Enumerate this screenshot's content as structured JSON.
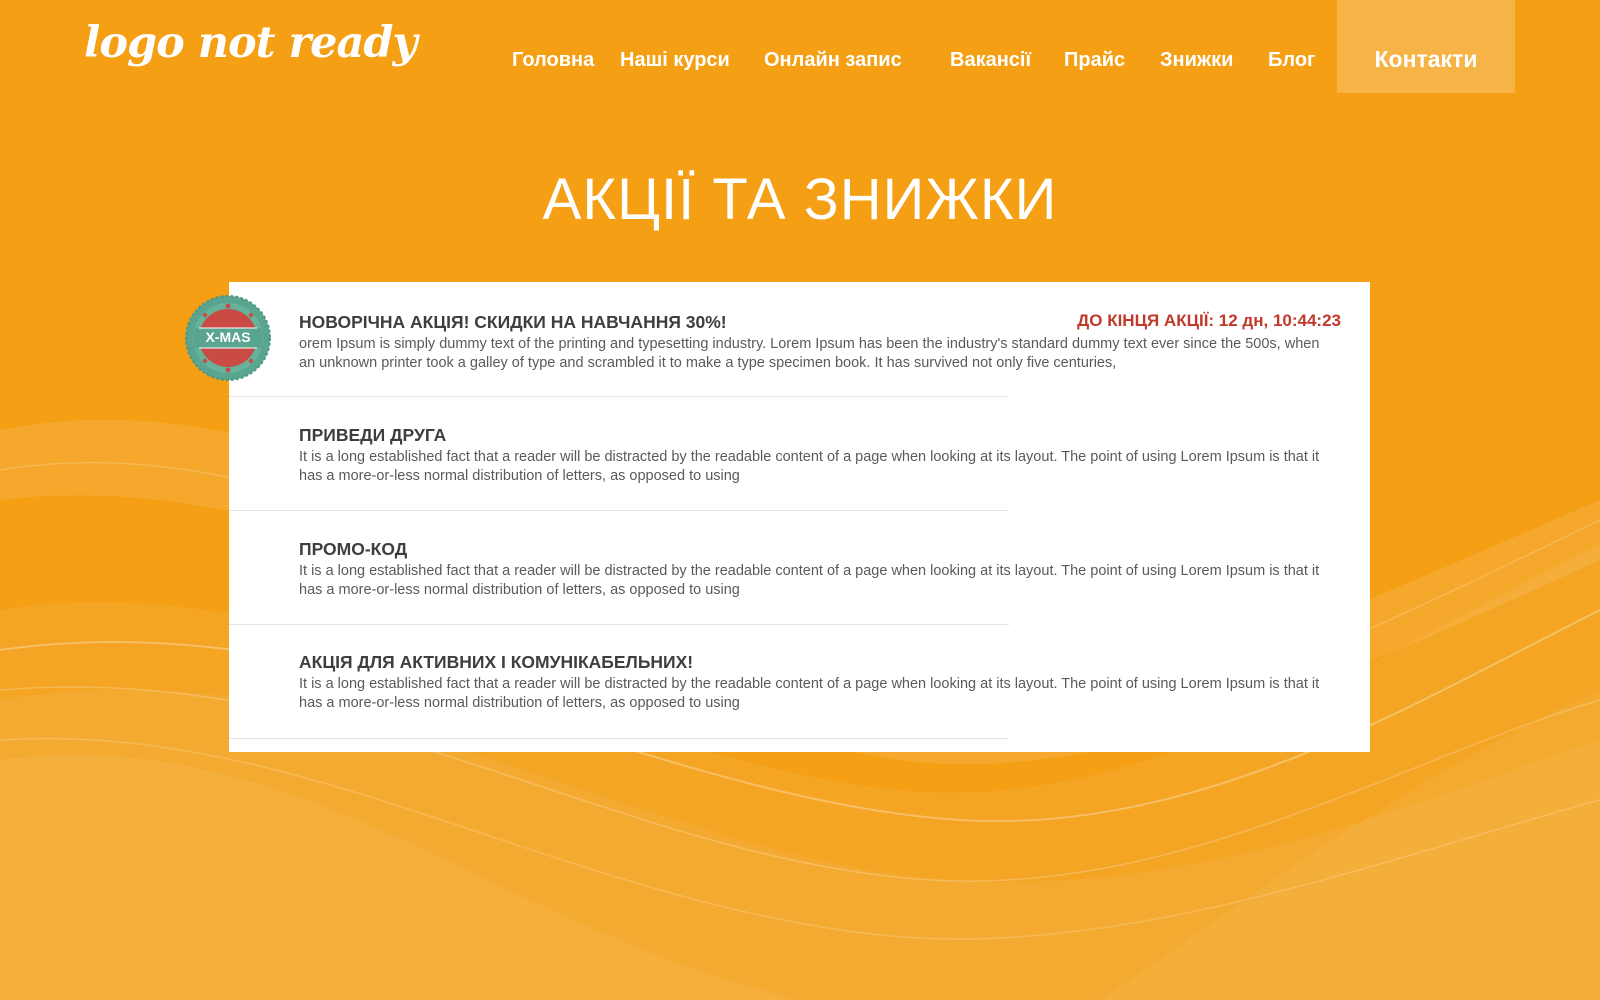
{
  "header": {
    "logo_text": "logo not ready",
    "nav": [
      {
        "label": "Головна"
      },
      {
        "label": "Наші курси"
      },
      {
        "label": "Онлайн запис"
      },
      {
        "label": "Вакансії"
      },
      {
        "label": "Прайс"
      },
      {
        "label": "Знижки"
      },
      {
        "label": "Блог"
      }
    ],
    "contacts_label": "Контакти"
  },
  "page_title": "АКЦІЇ ТА ЗНИЖКИ",
  "promos": [
    {
      "title": "НОВОРІЧНА АКЦІЯ! СКИДКИ НА НАВЧАННЯ 30%!",
      "text": "orem Ipsum is simply dummy text of the printing and typesetting industry. Lorem Ipsum has been the industry's standard dummy text ever since the 500s, when an unknown printer took a galley of type and scrambled it to make a type specimen book. It has survived not only five centuries,",
      "countdown": "ДО КІНЦЯ АКЦІЇ: 12 дн, 10:44:23",
      "badge": "X-MAS"
    },
    {
      "title": "ПРИВЕДИ ДРУГА",
      "text": "It is a long established fact that a reader will be distracted by the readable content of a page when looking at its layout. The point of using Lorem Ipsum is that it has a more-or-less normal distribution of letters, as opposed to using"
    },
    {
      "title": "ПРОМО-КОД",
      "text": "It is a long established fact that a reader will be distracted by the readable content of a page when looking at its layout. The point of using Lorem Ipsum is that it has a more-or-less normal distribution of letters, as opposed to using"
    },
    {
      "title": "АКЦІЯ ДЛЯ АКТИВНИХ І КОМУНІКАБЕЛЬНИХ!",
      "text": "It is a long established fact that a reader will be distracted by the readable content of a page when looking at its layout. The point of using Lorem Ipsum is that it has a more-or-less normal distribution of letters, as opposed to using"
    }
  ],
  "colors": {
    "background": "#f49f14",
    "countdown": "#c0392b",
    "badge_ring": "#5aa58f",
    "badge_center": "#c94b44"
  }
}
